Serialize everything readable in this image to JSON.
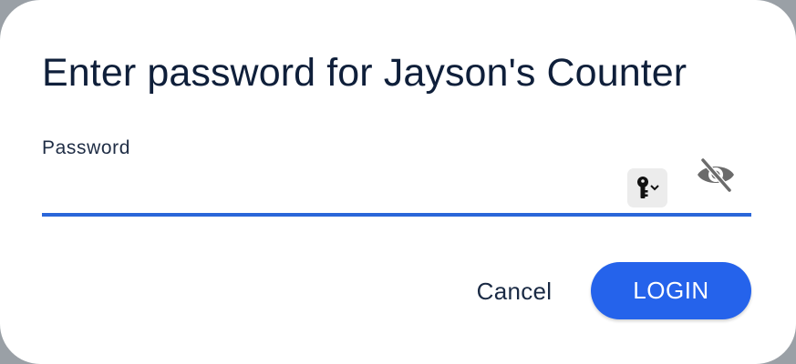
{
  "dialog": {
    "title": "Enter password for Jayson's Counter",
    "password_field": {
      "label": "Password",
      "value": "",
      "placeholder": ""
    },
    "icons": {
      "key": "key-icon",
      "visibility": "eye-off-icon"
    },
    "buttons": {
      "cancel_label": "Cancel",
      "login_label": "LOGIN"
    },
    "colors": {
      "accent": "#2563eb",
      "underline": "#2a66d9",
      "title_text": "#0f1f3a"
    }
  }
}
